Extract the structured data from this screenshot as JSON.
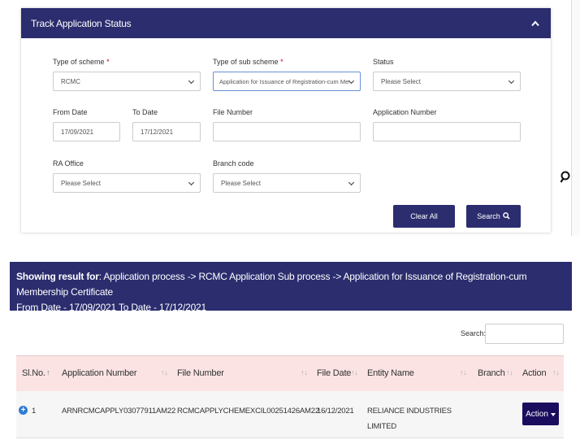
{
  "panel": {
    "title": "Track Application Status",
    "scheme": {
      "label": "Type of scheme",
      "required": "*",
      "value": "RCMC"
    },
    "sub_scheme": {
      "label": "Type of sub scheme",
      "required": "*",
      "value": "Application for Issuance of Registration-cum Members"
    },
    "status": {
      "label": "Status",
      "value": "Please Select"
    },
    "from_date": {
      "label": "From Date",
      "value": "17/09/2021"
    },
    "to_date": {
      "label": "To Date",
      "value": "17/12/2021"
    },
    "file_number": {
      "label": "File Number",
      "value": ""
    },
    "application_number": {
      "label": "Application Number",
      "value": ""
    },
    "ra_office": {
      "label": "RA Office",
      "value": "Please Select"
    },
    "branch_code": {
      "label": "Branch code",
      "value": "Please Select"
    },
    "clear_label": "Clear All",
    "search_label": "Search"
  },
  "result": {
    "prefix": "Showing result for",
    "text": ": Application process -> RCMC Application Sub process -> Application for Issuance of Registration-cum Membership Certificate",
    "line2": "From Date - 17/09/2021 To Date - 17/12/2021"
  },
  "table": {
    "search_label": "Search:",
    "columns": [
      "Sl.No.",
      "Application Number",
      "File Number",
      "File Date",
      "Entity Name",
      "Branch",
      "Action"
    ],
    "rows": [
      {
        "sl": "1",
        "application_number": "ARNRCMCAPPLY03077911AM22",
        "file_number": "RCMCAPPLYCHEMEXCIL00251426AM22",
        "file_date": "16/12/2021",
        "entity_line1": "RELIANCE INDUSTRIES",
        "entity_line2": "LIMITED",
        "branch": "",
        "action_label": "Action"
      }
    ]
  },
  "icons": {
    "collapse": "chevron-up-icon",
    "search": "search-icon",
    "side": "side-search-icon",
    "expand": "plus-circle-icon",
    "sort": "sort-icon",
    "caret": "caret-down-icon"
  },
  "colors": {
    "brand": "#2b2d6e",
    "header_row": "#fbe3e3",
    "required": "#d0021b",
    "action": "#1a0d5e"
  }
}
